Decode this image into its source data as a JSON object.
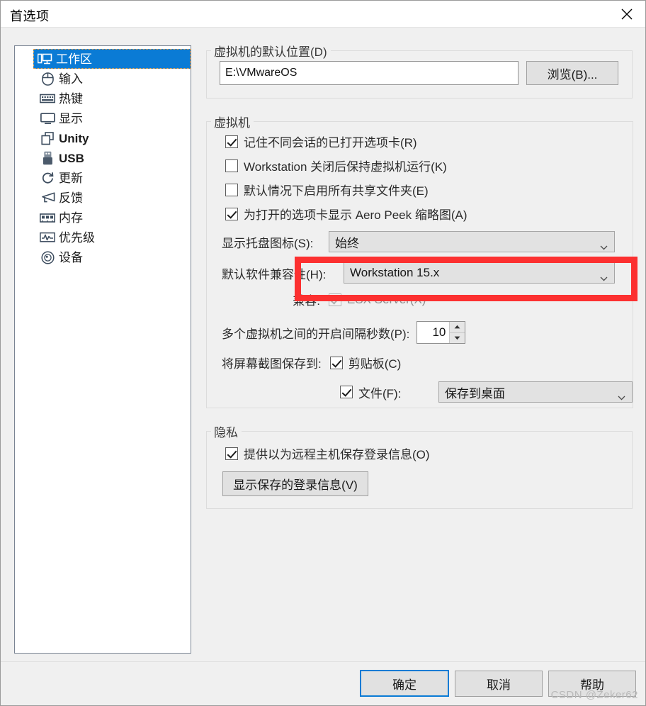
{
  "window": {
    "title": "首选项",
    "close_icon": "close-icon"
  },
  "sidebar": {
    "items": [
      {
        "label": "工作区",
        "icon": "monitor-workspace-icon",
        "selected": true,
        "latin": false
      },
      {
        "label": "输入",
        "icon": "mouse-icon",
        "selected": false,
        "latin": false
      },
      {
        "label": "热键",
        "icon": "keyboard-icon",
        "selected": false,
        "latin": false
      },
      {
        "label": "显示",
        "icon": "display-icon",
        "selected": false,
        "latin": false
      },
      {
        "label": "Unity",
        "icon": "windows-overlap-icon",
        "selected": false,
        "latin": true
      },
      {
        "label": "USB",
        "icon": "usb-icon",
        "selected": false,
        "latin": true
      },
      {
        "label": "更新",
        "icon": "refresh-icon",
        "selected": false,
        "latin": false
      },
      {
        "label": "反馈",
        "icon": "megaphone-icon",
        "selected": false,
        "latin": false
      },
      {
        "label": "内存",
        "icon": "memory-chip-icon",
        "selected": false,
        "latin": false
      },
      {
        "label": "优先级",
        "icon": "waveform-icon",
        "selected": false,
        "latin": false
      },
      {
        "label": "设备",
        "icon": "disc-icon",
        "selected": false,
        "latin": false
      }
    ]
  },
  "default_location": {
    "legend": "虚拟机的默认位置(D)",
    "path_value": "E:\\VMwareOS",
    "browse_button": "浏览(B)..."
  },
  "virtual_machine": {
    "legend": "虚拟机",
    "checkboxes": [
      {
        "label": "记住不同会话的已打开选项卡(R)",
        "checked": true
      },
      {
        "label": "Workstation 关闭后保持虚拟机运行(K)",
        "checked": false
      },
      {
        "label": "默认情况下启用所有共享文件夹(E)",
        "checked": false
      },
      {
        "label": "为打开的选项卡显示 Aero Peek 缩略图(A)",
        "checked": true
      }
    ],
    "tray_icon_label": "显示托盘图标(S):",
    "tray_icon_value": "始终",
    "compat_label": "默认软件兼容性(H):",
    "compat_value": "Workstation 15.x",
    "esx_prefix": "兼容:",
    "esx_label": "ESX Server(X)",
    "esx_checked": true,
    "esx_disabled": true,
    "startup_delay_label": "多个虚拟机之间的开启间隔秒数(P):",
    "startup_delay_value": "10",
    "screenshot_label": "将屏幕截图保存到:",
    "clipboard_label": "剪贴板(C)",
    "clipboard_checked": true,
    "file_label": "文件(F):",
    "file_checked": true,
    "file_target_value": "保存到桌面"
  },
  "privacy": {
    "legend": "隐私",
    "checkbox_label": "提供以为远程主机保存登录信息(O)",
    "checkbox_checked": true,
    "show_credentials_button": "显示保存的登录信息(V)"
  },
  "footer": {
    "ok_button": "确定",
    "cancel_button": "取消",
    "help_button": "帮助",
    "watermark": "CSDN @Zeker62"
  },
  "colors": {
    "accent": "#0a7bd5",
    "highlight_rect": "#fc3030",
    "dialog_bg": "#f0f0f0"
  }
}
